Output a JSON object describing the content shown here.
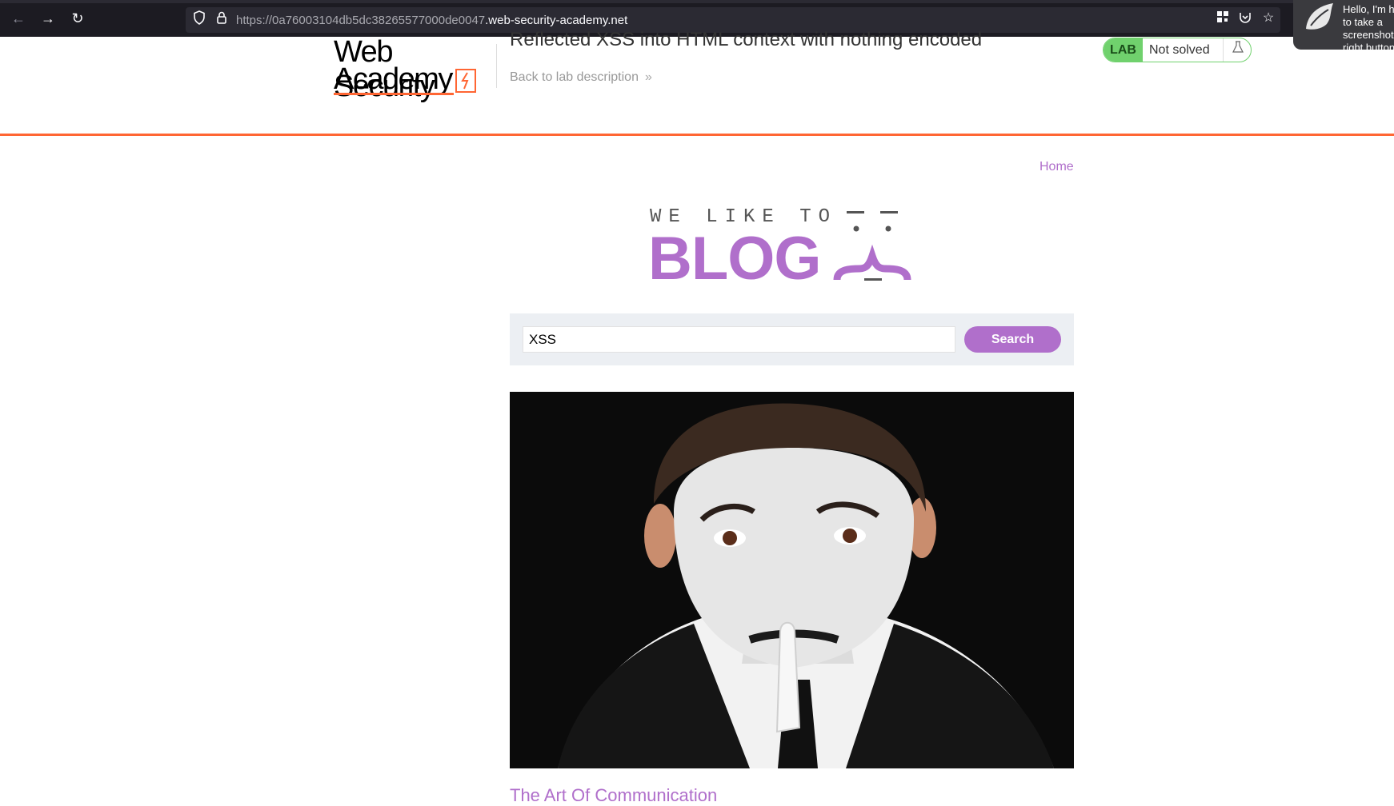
{
  "browser": {
    "url_prefix": "https://0a76003104db5dc38265577000de0047",
    "url_domain": ".web-security-academy.net",
    "back_icon": "arrow-left-icon",
    "forward_icon": "arrow-right-icon",
    "reload_icon": "reload-icon",
    "helper_popup_text": "Hello, I'm here to take a screenshot, right button"
  },
  "academy_header": {
    "logo_line1": "Web Security",
    "logo_line2": "Academy",
    "lab_title": "Reflected XSS into HTML context with nothing encoded",
    "back_link": "Back to lab description",
    "back_chevron": "»",
    "lab_badge": "LAB",
    "lab_status": "Not solved",
    "accent_color": "#ff6633",
    "solved_color": "#70d16d"
  },
  "blog": {
    "home_link": "Home",
    "logo_tagline": "WE LIKE TO",
    "logo_word": "BLOG",
    "search_value": "XSS",
    "search_button": "Search",
    "post_title": "The Art Of Communication",
    "accent_color": "#b06fcb"
  }
}
